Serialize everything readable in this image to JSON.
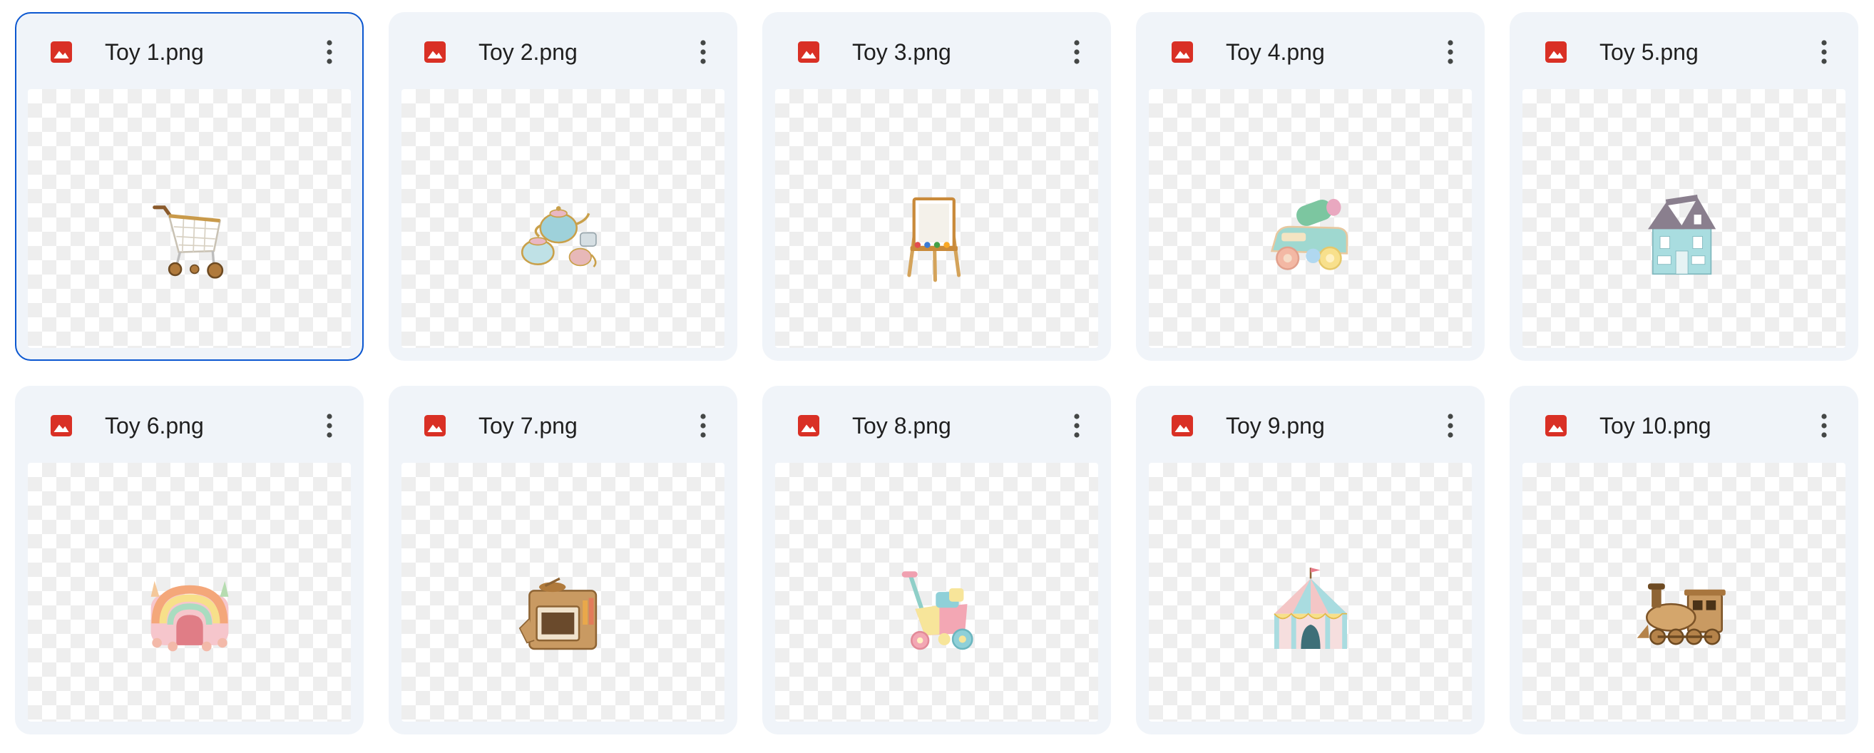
{
  "files": [
    {
      "name": "Toy 1.png",
      "selected": true,
      "toy": "shopping-cart"
    },
    {
      "name": "Toy 2.png",
      "selected": false,
      "toy": "tea-set"
    },
    {
      "name": "Toy 3.png",
      "selected": false,
      "toy": "easel"
    },
    {
      "name": "Toy 4.png",
      "selected": false,
      "toy": "toy-truck"
    },
    {
      "name": "Toy 5.png",
      "selected": false,
      "toy": "doll-house"
    },
    {
      "name": "Toy 6.png",
      "selected": false,
      "toy": "bounce-house"
    },
    {
      "name": "Toy 7.png",
      "selected": false,
      "toy": "play-kitchen"
    },
    {
      "name": "Toy 8.png",
      "selected": false,
      "toy": "walker-wagon"
    },
    {
      "name": "Toy 9.png",
      "selected": false,
      "toy": "circus-tent"
    },
    {
      "name": "Toy 10.png",
      "selected": false,
      "toy": "toy-train"
    }
  ],
  "colors": {
    "card_background": "#f0f4f9",
    "selected_border": "#0b57d0",
    "image_icon": "#d93025",
    "text": "#1f1f1f",
    "more_icon": "#444746"
  },
  "icons": {
    "file_type": "image-icon",
    "menu": "more-vert-icon"
  }
}
